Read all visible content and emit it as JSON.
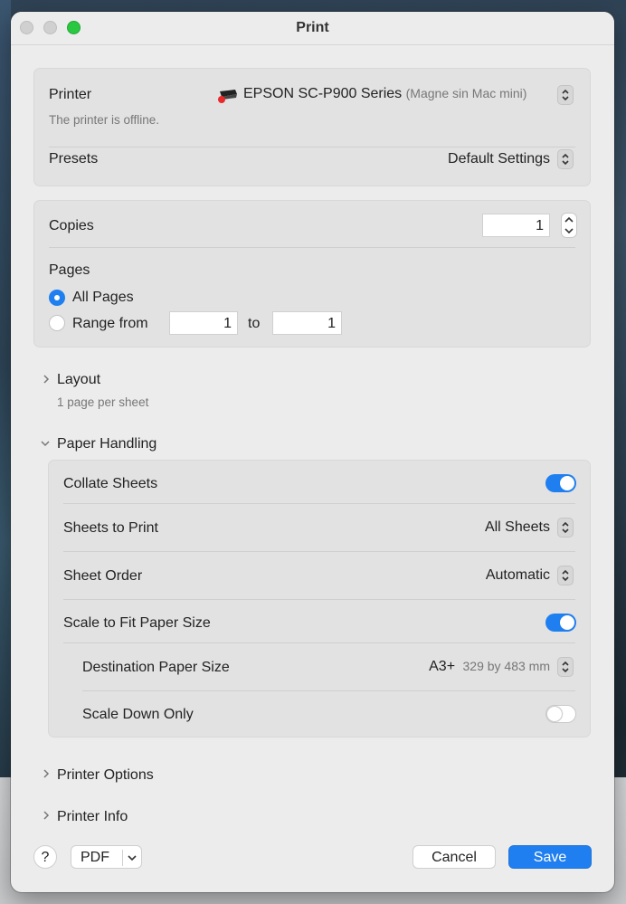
{
  "window": {
    "title": "Print"
  },
  "printer": {
    "label": "Printer",
    "name": "EPSON SC-P900 Series",
    "location": "(Magne sin Mac mini)",
    "status": "The printer is offline.",
    "status_dot_color": "#e82a2a"
  },
  "presets": {
    "label": "Presets",
    "value": "Default Settings"
  },
  "copies": {
    "label": "Copies",
    "value": "1"
  },
  "pages": {
    "label": "Pages",
    "all_pages": "All Pages",
    "range_from": "Range from",
    "range_to_label": "to",
    "range_from_value": "1",
    "range_to_value": "1",
    "selected": "All Pages"
  },
  "layout": {
    "label": "Layout",
    "summary": "1 page per sheet",
    "expanded": false
  },
  "paper_handling": {
    "label": "Paper Handling",
    "expanded": true,
    "collate_label": "Collate Sheets",
    "collate_on": true,
    "sheets_to_print_label": "Sheets to Print",
    "sheets_to_print_value": "All Sheets",
    "sheet_order_label": "Sheet Order",
    "sheet_order_value": "Automatic",
    "scale_fit_label": "Scale to Fit Paper Size",
    "scale_fit_on": true,
    "dest_paper_label": "Destination Paper Size",
    "dest_paper_value": "A3+",
    "dest_paper_dims": "329 by 483 mm",
    "scale_down_label": "Scale Down Only",
    "scale_down_on": false
  },
  "printer_options": {
    "label": "Printer Options"
  },
  "printer_info": {
    "label": "Printer Info"
  },
  "footer": {
    "help": "?",
    "pdf": "PDF",
    "cancel": "Cancel",
    "save": "Save"
  },
  "colors": {
    "accent": "#1f7ff0",
    "close": "#d0d0d0",
    "zoom": "#2ac840"
  }
}
